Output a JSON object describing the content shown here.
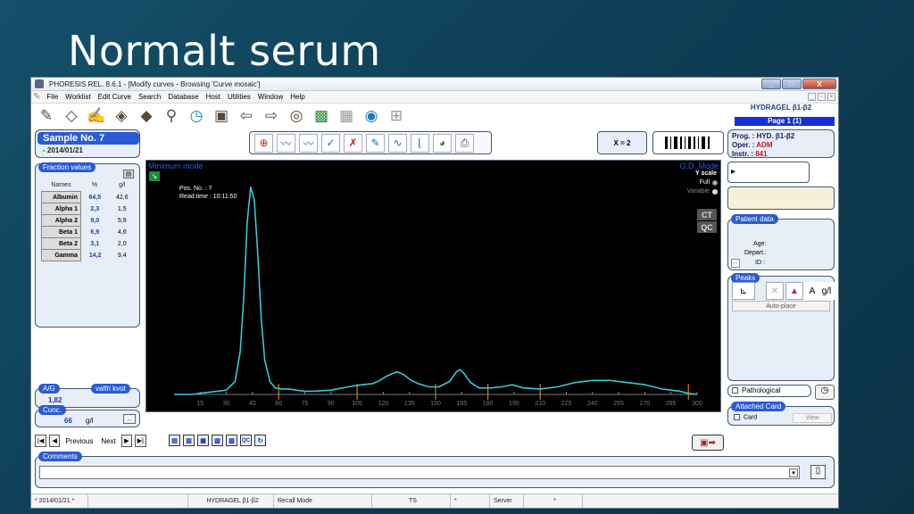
{
  "slide": {
    "title": "Normalt serum"
  },
  "window": {
    "title": "PHORESIS REL. 8.6.1 - [Modify curves - Browsing 'Curve mosaic']",
    "buttons": {
      "min": "_",
      "max": "□",
      "close": "X"
    }
  },
  "menu": [
    "File",
    "Worklist",
    "Edit Curve",
    "Search",
    "Database",
    "Host",
    "Utilities",
    "Window",
    "Help"
  ],
  "header_right": {
    "program": "HYDRAGEL β1-β2",
    "page": "Page 1 (1)"
  },
  "sample": {
    "title": "Sample No.  7",
    "date": "- 2014/01/21"
  },
  "fraction_values": {
    "label": "Fraction values",
    "headers": [
      "Names",
      "%",
      "g/l"
    ],
    "rows": [
      {
        "name": "Albumin",
        "pct": "64,5",
        "gl": "42,6"
      },
      {
        "name": "Alpha 1",
        "pct": "2,3",
        "gl": "1,5"
      },
      {
        "name": "Alpha 2",
        "pct": "9,0",
        "gl": "5,9"
      },
      {
        "name": "Beta 1",
        "pct": "6,9",
        "gl": "4,6"
      },
      {
        "name": "Beta 2",
        "pct": "3,1",
        "gl": "2,0"
      },
      {
        "name": "Gamma",
        "pct": "14,2",
        "gl": "9,4"
      }
    ]
  },
  "ag": {
    "label": "A/G",
    "value": "1,82",
    "label2": "valfri kvot"
  },
  "conc": {
    "label": "Conc.",
    "value": "66",
    "unit": "g/l",
    "button": "..."
  },
  "navigation": {
    "previous": "Previous",
    "next": "Next"
  },
  "view_buttons": [
    "QC"
  ],
  "x_info": "X = 2",
  "chart": {
    "mode": "Minimum mode",
    "od_mode": "O.D. Mode",
    "y_scale": "Y scale",
    "full": "Full",
    "variable": "Variable",
    "pos_no": "Pos. No. : 7",
    "read_time": "Read time : 10:11:50",
    "ct": "CT",
    "qc": "QC"
  },
  "chart_data": {
    "type": "line",
    "xlabel": "",
    "ylabel": "",
    "x_ticks": [
      15,
      30,
      45,
      60,
      75,
      90,
      105,
      120,
      135,
      150,
      165,
      180,
      195,
      210,
      225,
      240,
      255,
      270,
      285,
      300
    ],
    "xlim": [
      0,
      300
    ],
    "ylim": [
      0,
      100
    ],
    "series": [
      {
        "x": [
          0,
          10,
          20,
          30,
          35,
          38,
          40,
          42,
          44,
          46,
          48,
          50,
          52,
          55,
          58,
          62,
          66,
          70,
          75,
          80,
          90,
          100,
          108,
          114,
          118,
          122,
          128,
          132,
          136,
          140,
          146,
          152,
          158,
          162,
          164,
          166,
          170,
          175,
          182,
          188,
          194,
          200,
          210,
          220,
          230,
          240,
          250,
          260,
          270,
          280,
          290,
          295,
          300
        ],
        "y": [
          0,
          0,
          1,
          2,
          6,
          20,
          45,
          80,
          96,
          90,
          65,
          35,
          16,
          6,
          3,
          2.5,
          2.5,
          2,
          1.5,
          1.5,
          2,
          3.5,
          4.5,
          5,
          6.5,
          8.5,
          10.5,
          9,
          6.5,
          5,
          3.5,
          3.5,
          6,
          10.5,
          11.5,
          10,
          5.5,
          3,
          3,
          3.5,
          4.5,
          3,
          2.5,
          3.5,
          5.5,
          6.5,
          6.5,
          5.5,
          4.5,
          2.5,
          1.5,
          0.5,
          0
        ]
      }
    ],
    "fraction_separators": [
      60,
      105,
      150,
      180,
      210,
      295
    ],
    "grid": false
  },
  "right_panel": {
    "prog": "HYD. β1-β2",
    "oper": "ADM",
    "instr": "841",
    "patient": {
      "label": "Patient data",
      "age": "Age:",
      "depart": "Depart.:",
      "id": "ID :",
      "btn": "..."
    },
    "peaks": {
      "label": "Peaks",
      "autoplace": "Auto-place",
      "a": "A",
      "gl": "g/l"
    },
    "pathological": "Pathological",
    "attached": {
      "label": "Attached Card",
      "card": "Card",
      "view": "View"
    }
  },
  "comments": {
    "label": "Comments"
  },
  "status": [
    "* 2014/01/21 *",
    "",
    "HYDRAGEL β1-β2",
    "Recall Mode",
    "TS",
    "*",
    "Server",
    "*"
  ],
  "colors": {
    "accent": "#2a5bd7",
    "curve": "#39c6d8",
    "separator": "#e07a10"
  }
}
